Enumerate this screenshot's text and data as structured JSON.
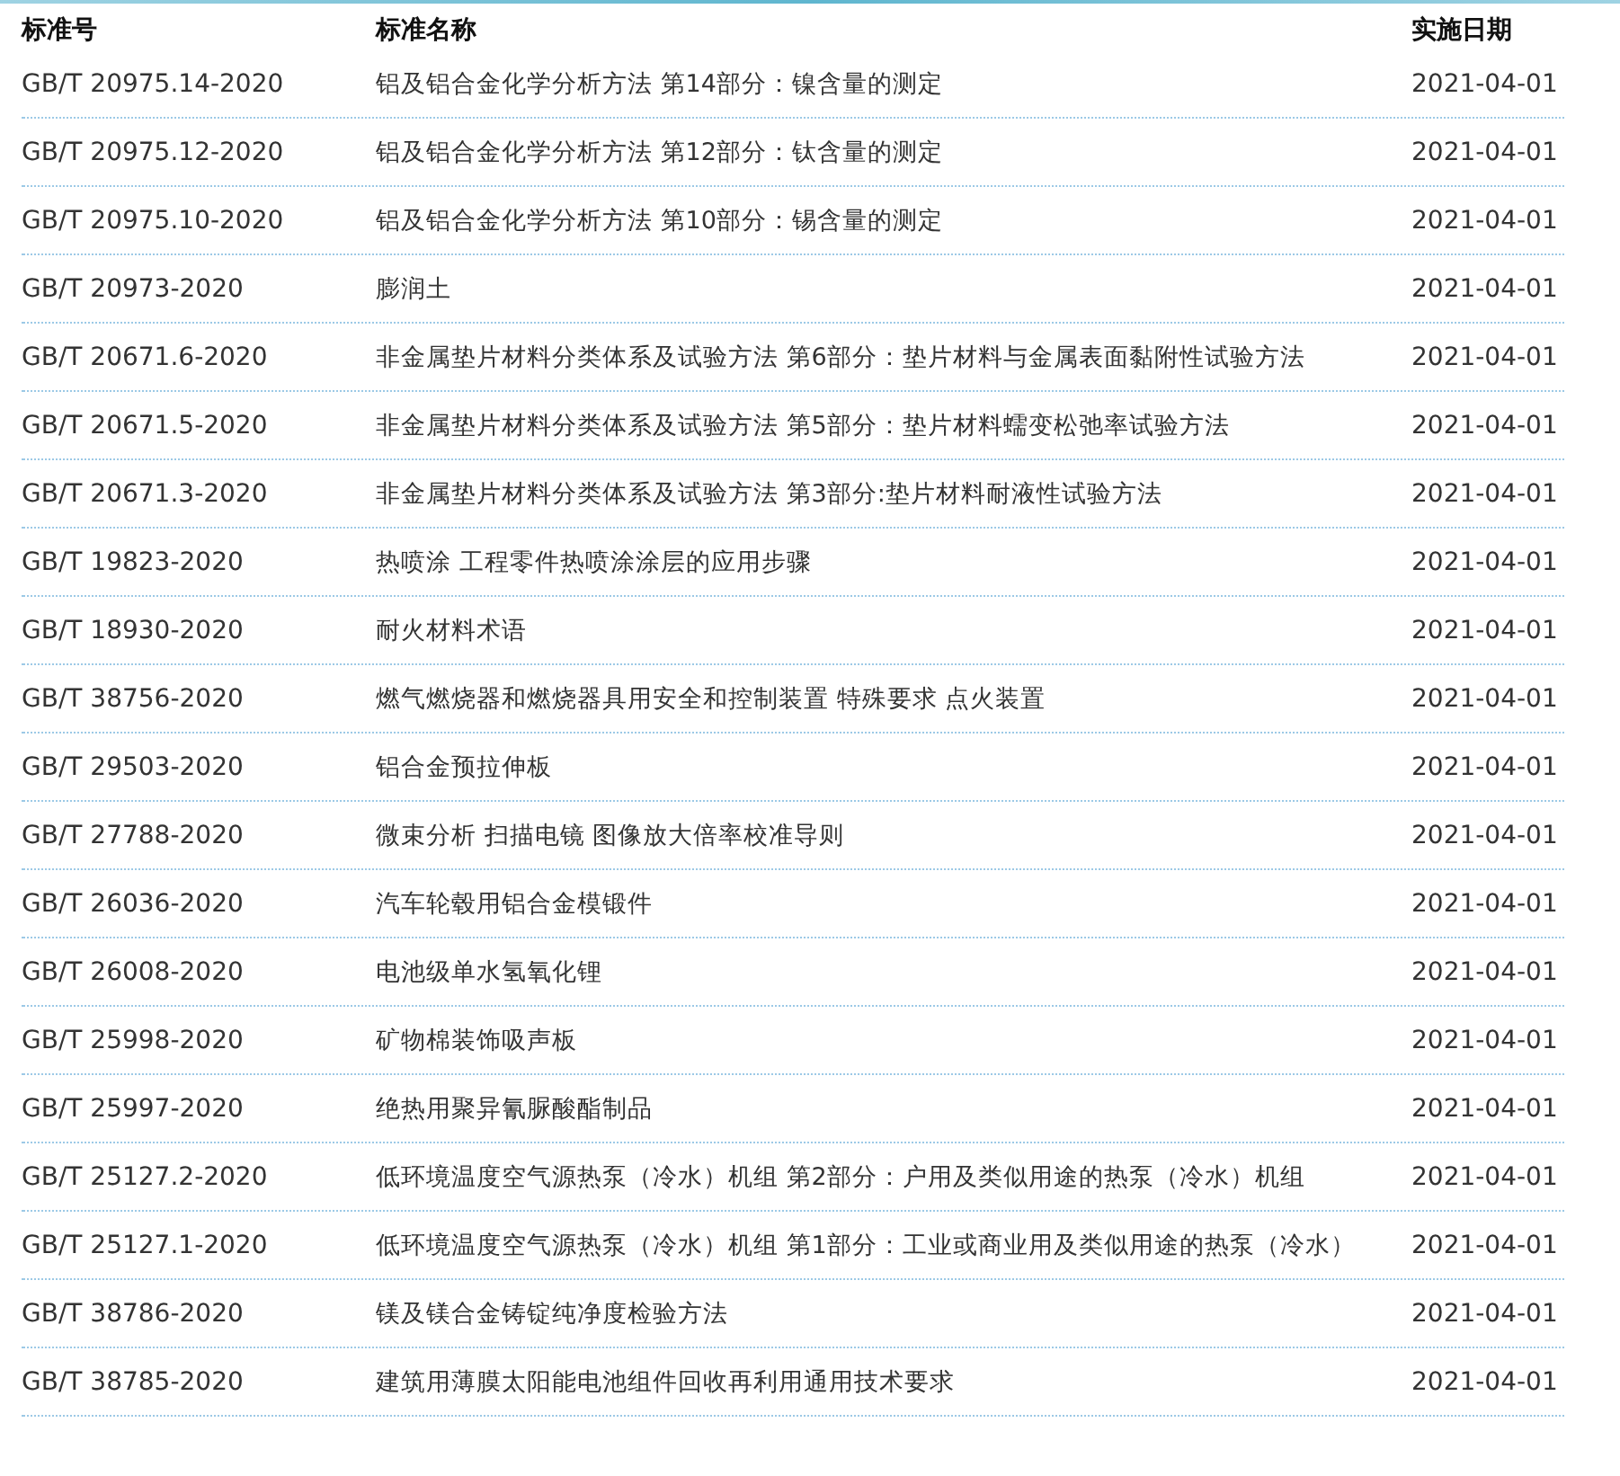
{
  "table": {
    "columns": [
      "标准号",
      "标准名称",
      "实施日期"
    ],
    "rows": [
      {
        "code": "GB/T 20975.14-2020",
        "name": "铝及铝合金化学分析方法 第14部分：镍含量的测定",
        "date": "2021-04-01"
      },
      {
        "code": "GB/T 20975.12-2020",
        "name": "铝及铝合金化学分析方法 第12部分：钛含量的测定",
        "date": "2021-04-01"
      },
      {
        "code": "GB/T 20975.10-2020",
        "name": "铝及铝合金化学分析方法 第10部分：锡含量的测定",
        "date": "2021-04-01"
      },
      {
        "code": "GB/T 20973-2020",
        "name": "膨润土",
        "date": "2021-04-01"
      },
      {
        "code": "GB/T 20671.6-2020",
        "name": "非金属垫片材料分类体系及试验方法 第6部分：垫片材料与金属表面黏附性试验方法",
        "date": "2021-04-01"
      },
      {
        "code": "GB/T 20671.5-2020",
        "name": "非金属垫片材料分类体系及试验方法 第5部分：垫片材料蠕变松弛率试验方法",
        "date": "2021-04-01"
      },
      {
        "code": "GB/T 20671.3-2020",
        "name": "非金属垫片材料分类体系及试验方法 第3部分:垫片材料耐液性试验方法",
        "date": "2021-04-01"
      },
      {
        "code": "GB/T 19823-2020",
        "name": "热喷涂 工程零件热喷涂涂层的应用步骤",
        "date": "2021-04-01"
      },
      {
        "code": "GB/T 18930-2020",
        "name": "耐火材料术语",
        "date": "2021-04-01"
      },
      {
        "code": "GB/T 38756-2020",
        "name": "燃气燃烧器和燃烧器具用安全和控制装置 特殊要求 点火装置",
        "date": "2021-04-01"
      },
      {
        "code": "GB/T 29503-2020",
        "name": "铝合金预拉伸板",
        "date": "2021-04-01"
      },
      {
        "code": "GB/T 27788-2020",
        "name": "微束分析 扫描电镜 图像放大倍率校准导则",
        "date": "2021-04-01"
      },
      {
        "code": "GB/T 26036-2020",
        "name": "汽车轮毂用铝合金模锻件",
        "date": "2021-04-01"
      },
      {
        "code": "GB/T 26008-2020",
        "name": "电池级单水氢氧化锂",
        "date": "2021-04-01"
      },
      {
        "code": "GB/T 25998-2020",
        "name": "矿物棉装饰吸声板",
        "date": "2021-04-01"
      },
      {
        "code": "GB/T 25997-2020",
        "name": "绝热用聚异氰脲酸酯制品",
        "date": "2021-04-01"
      },
      {
        "code": "GB/T 25127.2-2020",
        "name": "低环境温度空气源热泵（冷水）机组 第2部分：户用及类似用途的热泵（冷水）机组",
        "date": "2021-04-01"
      },
      {
        "code": "GB/T 25127.1-2020",
        "name": "低环境温度空气源热泵（冷水）机组 第1部分：工业或商业用及类似用途的热泵（冷水）",
        "date": "2021-04-01"
      },
      {
        "code": "GB/T 38786-2020",
        "name": "镁及镁合金铸锭纯净度检验方法",
        "date": "2021-04-01"
      },
      {
        "code": "GB/T 38785-2020",
        "name": "建筑用薄膜太阳能电池组件回收再利用通用技术要求",
        "date": "2021-04-01"
      }
    ]
  }
}
